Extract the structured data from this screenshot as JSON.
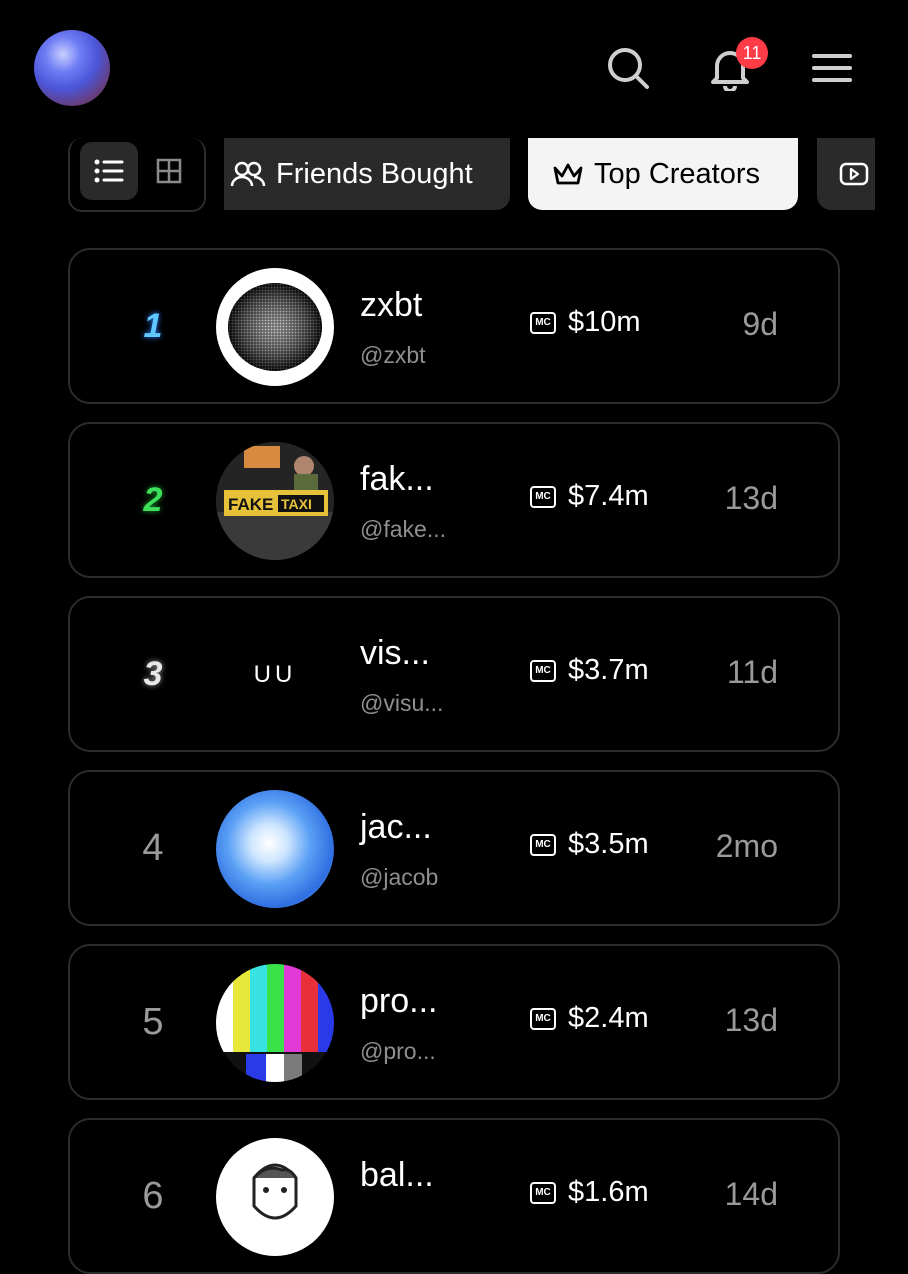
{
  "header": {
    "notification_count": "11"
  },
  "tabs": {
    "friends_label": "Friends Bought",
    "top_label": "Top Creators"
  },
  "creators": [
    {
      "rank": "1",
      "name": "zxbt",
      "handle": "@zxbt",
      "mc": "$10m",
      "age": "9d",
      "rank_color": "#5ec8ff"
    },
    {
      "rank": "2",
      "name": "fak...",
      "handle": "@fake...",
      "mc": "$7.4m",
      "age": "13d",
      "rank_color": "#3ee05a"
    },
    {
      "rank": "3",
      "name": "vis...",
      "handle": "@visu...",
      "mc": "$3.7m",
      "age": "11d",
      "rank_color": "#e8e8e8"
    },
    {
      "rank": "4",
      "name": "jac...",
      "handle": "@jacob",
      "mc": "$3.5m",
      "age": "2mo"
    },
    {
      "rank": "5",
      "name": "pro...",
      "handle": "@pro...",
      "mc": "$2.4m",
      "age": "13d"
    },
    {
      "rank": "6",
      "name": "bal...",
      "handle": "",
      "mc": "$1.6m",
      "age": "14d"
    }
  ],
  "mc_badge": "MC",
  "avatar_text_3": "UU",
  "taxi_text": {
    "fake": "FAKE",
    "taxi": "TAXI"
  }
}
